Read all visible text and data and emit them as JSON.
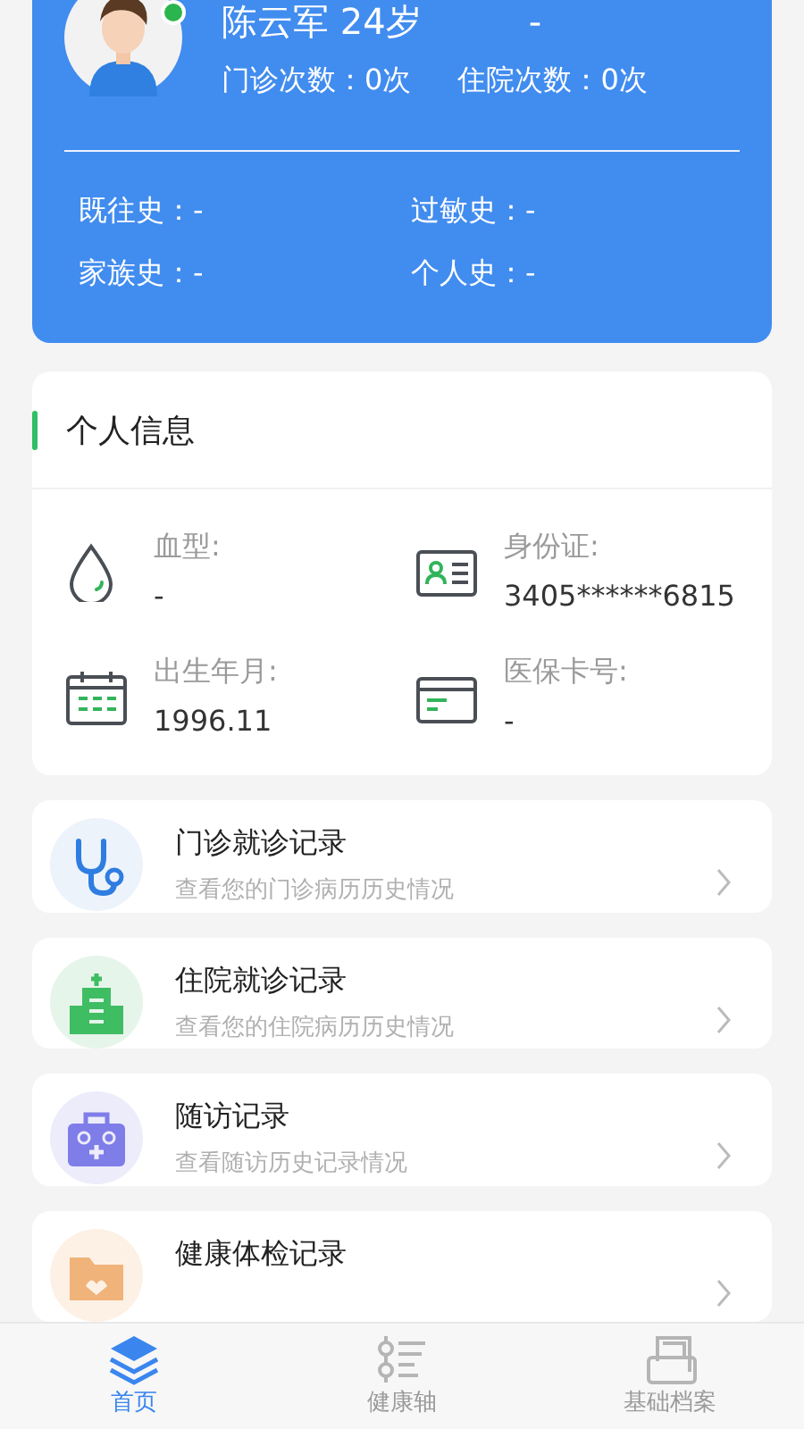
{
  "profile": {
    "name": "陈云军 24岁",
    "extra": "-",
    "visits": [
      {
        "label": "门诊次数：0次"
      },
      {
        "label": "住院次数：0次"
      }
    ],
    "histories": [
      {
        "label": "既往史：-"
      },
      {
        "label": "过敏史：-"
      },
      {
        "label": "家族史：-"
      },
      {
        "label": "个人史：-"
      }
    ]
  },
  "personal_info": {
    "title": "个人信息",
    "items": [
      {
        "kind": "blood",
        "label": "血型:",
        "value": "-"
      },
      {
        "kind": "id",
        "label": "身份证:",
        "value": "3405******6815"
      },
      {
        "kind": "birth",
        "label": "出生年月:",
        "value": "1996.11"
      },
      {
        "kind": "card",
        "label": "医保卡号:",
        "value": "-"
      }
    ]
  },
  "records": [
    {
      "kind": "outpatient",
      "title": "门诊就诊记录",
      "subtitle": "查看您的门诊病历历史情况"
    },
    {
      "kind": "inpatient",
      "title": "住院就诊记录",
      "subtitle": "查看您的住院病历历史情况"
    },
    {
      "kind": "followup",
      "title": "随访记录",
      "subtitle": "查看随访历史记录情况"
    },
    {
      "kind": "checkup",
      "title": "健康体检记录"
    }
  ],
  "tabs": [
    {
      "kind": "home",
      "label": "首页",
      "selected": true
    },
    {
      "kind": "timeline",
      "label": "健康轴",
      "selected": false
    },
    {
      "kind": "archive",
      "label": "基础档案",
      "selected": false
    }
  ]
}
